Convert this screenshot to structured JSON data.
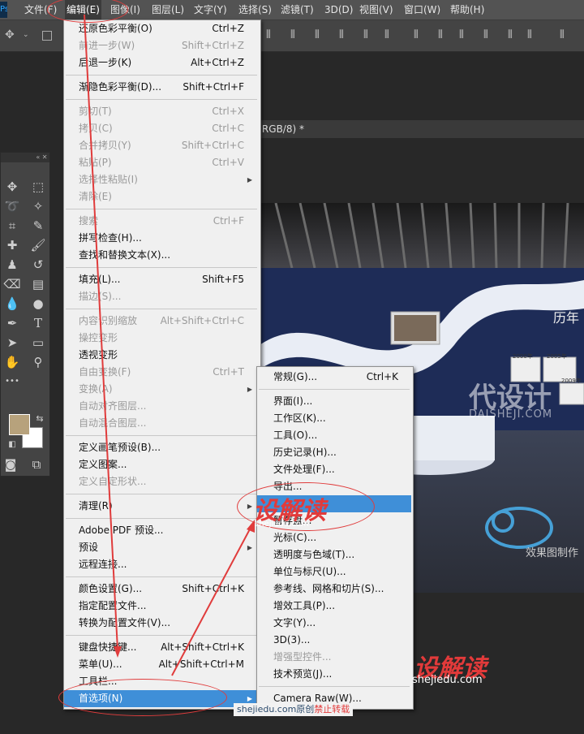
{
  "app": {
    "logo": "Ps"
  },
  "menubar": [
    "文件(F)",
    "编辑(E)",
    "图像(I)",
    "图层(L)",
    "文字(Y)",
    "选择(S)",
    "滤镜(T)",
    "3D(D)",
    "视图(V)",
    "窗口(W)",
    "帮助(H)"
  ],
  "document": {
    "tab_title": "s(RGB/8) *"
  },
  "edit_menu": [
    {
      "label": "还原色彩平衡(O)",
      "shortcut": "Ctrl+Z",
      "disabled": false
    },
    {
      "label": "前进一步(W)",
      "shortcut": "Shift+Ctrl+Z",
      "disabled": true
    },
    {
      "label": "后退一步(K)",
      "shortcut": "Alt+Ctrl+Z",
      "disabled": false
    },
    {
      "sep": true
    },
    {
      "label": "渐隐色彩平衡(D)...",
      "shortcut": "Shift+Ctrl+F",
      "disabled": false
    },
    {
      "sep": true
    },
    {
      "label": "剪切(T)",
      "shortcut": "Ctrl+X",
      "disabled": true
    },
    {
      "label": "拷贝(C)",
      "shortcut": "Ctrl+C",
      "disabled": true
    },
    {
      "label": "合并拷贝(Y)",
      "shortcut": "Shift+Ctrl+C",
      "disabled": true
    },
    {
      "label": "粘贴(P)",
      "shortcut": "Ctrl+V",
      "disabled": true
    },
    {
      "label": "选择性粘贴(I)",
      "shortcut": "",
      "disabled": true,
      "submenu": true
    },
    {
      "label": "清除(E)",
      "shortcut": "",
      "disabled": true
    },
    {
      "sep": true
    },
    {
      "label": "搜索",
      "shortcut": "Ctrl+F",
      "disabled": true
    },
    {
      "label": "拼写检查(H)...",
      "shortcut": "",
      "disabled": false
    },
    {
      "label": "查找和替换文本(X)...",
      "shortcut": "",
      "disabled": false
    },
    {
      "sep": true
    },
    {
      "label": "填充(L)...",
      "shortcut": "Shift+F5",
      "disabled": false
    },
    {
      "label": "描边(S)...",
      "shortcut": "",
      "disabled": true
    },
    {
      "sep": true
    },
    {
      "label": "内容识别缩放",
      "shortcut": "Alt+Shift+Ctrl+C",
      "disabled": true
    },
    {
      "label": "操控变形",
      "shortcut": "",
      "disabled": true
    },
    {
      "label": "透视变形",
      "shortcut": "",
      "disabled": false
    },
    {
      "label": "自由变换(F)",
      "shortcut": "Ctrl+T",
      "disabled": true
    },
    {
      "label": "变换(A)",
      "shortcut": "",
      "disabled": true,
      "submenu": true
    },
    {
      "label": "自动对齐图层...",
      "shortcut": "",
      "disabled": true
    },
    {
      "label": "自动混合图层...",
      "shortcut": "",
      "disabled": true
    },
    {
      "sep": true
    },
    {
      "label": "定义画笔预设(B)...",
      "shortcut": "",
      "disabled": false
    },
    {
      "label": "定义图案...",
      "shortcut": "",
      "disabled": false
    },
    {
      "label": "定义自定形状...",
      "shortcut": "",
      "disabled": true
    },
    {
      "sep": true
    },
    {
      "label": "清理(R)",
      "shortcut": "",
      "disabled": false,
      "submenu": true
    },
    {
      "sep": true
    },
    {
      "label": "Adobe PDF 预设...",
      "shortcut": "",
      "disabled": false
    },
    {
      "label": "预设",
      "shortcut": "",
      "disabled": false,
      "submenu": true
    },
    {
      "label": "远程连接...",
      "shortcut": "",
      "disabled": false
    },
    {
      "sep": true
    },
    {
      "label": "颜色设置(G)...",
      "shortcut": "Shift+Ctrl+K",
      "disabled": false
    },
    {
      "label": "指定配置文件...",
      "shortcut": "",
      "disabled": false
    },
    {
      "label": "转换为配置文件(V)...",
      "shortcut": "",
      "disabled": false
    },
    {
      "sep": true
    },
    {
      "label": "键盘快捷键...",
      "shortcut": "Alt+Shift+Ctrl+K",
      "disabled": false
    },
    {
      "label": "菜单(U)...",
      "shortcut": "Alt+Shift+Ctrl+M",
      "disabled": false
    },
    {
      "label": "工具栏...",
      "shortcut": "",
      "disabled": false
    },
    {
      "label": "首选项(N)",
      "shortcut": "",
      "disabled": false,
      "submenu": true,
      "highlight": true
    }
  ],
  "prefs_submenu": [
    {
      "label": "常规(G)...",
      "shortcut": "Ctrl+K"
    },
    {
      "sep": true
    },
    {
      "label": "界面(I)...",
      "shortcut": ""
    },
    {
      "label": "工作区(K)...",
      "shortcut": ""
    },
    {
      "label": "工具(O)...",
      "shortcut": ""
    },
    {
      "label": "历史记录(H)...",
      "shortcut": ""
    },
    {
      "label": "文件处理(F)...",
      "shortcut": ""
    },
    {
      "label": "导出...",
      "shortcut": ""
    },
    {
      "label": "",
      "shortcut": "",
      "highlight": true
    },
    {
      "label": "暂存盘...",
      "shortcut": ""
    },
    {
      "label": "光标(C)...",
      "shortcut": ""
    },
    {
      "label": "透明度与色域(T)...",
      "shortcut": ""
    },
    {
      "label": "单位与标尺(U)...",
      "shortcut": ""
    },
    {
      "label": "参考线、网格和切片(S)...",
      "shortcut": ""
    },
    {
      "label": "增效工具(P)...",
      "shortcut": ""
    },
    {
      "label": "文字(Y)...",
      "shortcut": ""
    },
    {
      "label": "3D(3)...",
      "shortcut": ""
    },
    {
      "label": "增强型控件...",
      "shortcut": "",
      "disabled": true
    },
    {
      "label": "技术预览(J)...",
      "shortcut": ""
    },
    {
      "sep": true
    },
    {
      "label": "Camera Raw(W)...",
      "shortcut": ""
    }
  ],
  "canvas": {
    "title_text": "历年",
    "watermark_cn": "代设计",
    "watermark_en": "DAISHEJI.COM",
    "caption": "效果图制作",
    "timeline_years": [
      "2000年",
      "2005年",
      "2009年"
    ]
  },
  "watermarks": {
    "brand1": "设解读",
    "brand1_sub": "shejiedu.com",
    "brand2": "设解读",
    "brand2_sub": "shejiedu.com",
    "footer": "shejiedu.com原创",
    "footer_warn": "禁止转载"
  },
  "colors": {
    "highlight": "#3f8fd8",
    "annotation": "#e03c3c",
    "brand_red": "#e23a3a",
    "brand_dark": "#2b4a6b"
  }
}
